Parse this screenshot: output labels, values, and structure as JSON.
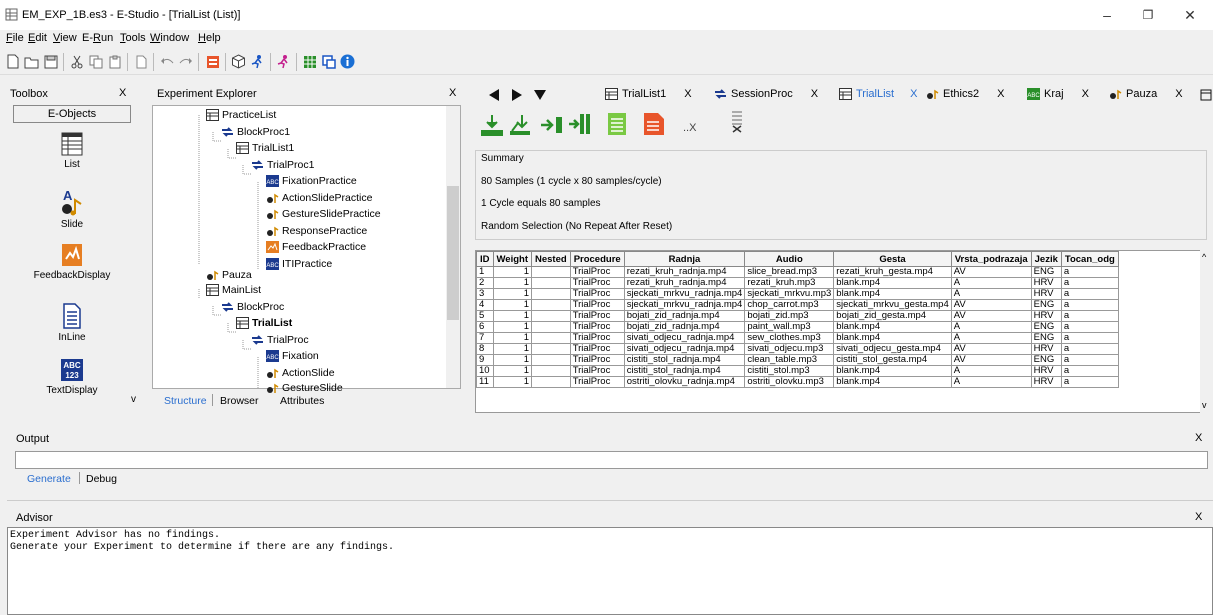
{
  "window": {
    "title": "EM_EXP_1B.es3 - E-Studio - [TrialList (List)]",
    "minimize": "–",
    "restore": "❐",
    "close": "✕"
  },
  "menu": [
    "File",
    "Edit",
    "View",
    "E-Run",
    "Tools",
    "Window",
    "Help"
  ],
  "toolbox": {
    "title": "Toolbox",
    "close": "X",
    "category": "E-Objects",
    "items": [
      "List",
      "Slide",
      "FeedbackDisplay",
      "InLine",
      "TextDisplay"
    ],
    "scroll_indicator": "v"
  },
  "explorer": {
    "title": "Experiment Explorer",
    "close": "X",
    "tree": [
      {
        "label": "PracticeList",
        "type": "list"
      },
      {
        "label": "BlockProc1",
        "type": "proc"
      },
      {
        "label": "TrialList1",
        "type": "list"
      },
      {
        "label": "TrialProc1",
        "type": "proc"
      },
      {
        "label": "FixationPractice",
        "type": "text"
      },
      {
        "label": "ActionSlidePractice",
        "type": "slide"
      },
      {
        "label": "GestureSlidePractice",
        "type": "slide"
      },
      {
        "label": "ResponsePractice",
        "type": "slide"
      },
      {
        "label": "FeedbackPractice",
        "type": "feedback"
      },
      {
        "label": "ITIPractice",
        "type": "text"
      },
      {
        "label": "Pauza",
        "type": "slide"
      },
      {
        "label": "MainList",
        "type": "list"
      },
      {
        "label": "BlockProc",
        "type": "proc"
      },
      {
        "label": "TrialList",
        "type": "list"
      },
      {
        "label": "TrialProc",
        "type": "proc"
      },
      {
        "label": "Fixation",
        "type": "text"
      },
      {
        "label": "ActionSlide",
        "type": "slide"
      },
      {
        "label": "GestureSlide",
        "type": "slide"
      }
    ],
    "tabs": [
      "Structure",
      "Browser",
      "Attributes"
    ]
  },
  "doc_tabs": [
    {
      "label": "TrialList1",
      "close": "X",
      "type": "list"
    },
    {
      "label": "SessionProc",
      "close": "X",
      "type": "proc"
    },
    {
      "label": "TrialList",
      "close": "X",
      "type": "list",
      "active": true
    },
    {
      "label": "Ethics2",
      "close": "X",
      "type": "slide"
    },
    {
      "label": "Kraj",
      "close": "X",
      "type": "text"
    },
    {
      "label": "Pauza",
      "close": "X",
      "type": "slide"
    }
  ],
  "summary": {
    "title": "Summary",
    "lines": [
      "80 Samples (1 cycle x 80 samples/cycle)",
      "1 Cycle equals 80 samples",
      "Random Selection  (No Repeat After Reset)"
    ]
  },
  "list_tool_extra": "..X",
  "grid": {
    "columns": [
      "ID",
      "Weight",
      "Nested",
      "Procedure",
      "Radnja",
      "Audio",
      "Gesta",
      "Vrsta_podrazaja",
      "Jezik",
      "Tocan_odg"
    ],
    "rows": [
      [
        "1",
        "1",
        "",
        "TrialProc",
        "rezati_kruh_radnja.mp4",
        "slice_bread.mp3",
        "rezati_kruh_gesta.mp4",
        "AV",
        "ENG",
        "a"
      ],
      [
        "2",
        "1",
        "",
        "TrialProc",
        "rezati_kruh_radnja.mp4",
        "rezati_kruh.mp3",
        "blank.mp4",
        "A",
        "HRV",
        "a"
      ],
      [
        "3",
        "1",
        "",
        "TrialProc",
        "sjeckati_mrkvu_radnja.mp4",
        "sjeckati_mrkvu.mp3",
        "blank.mp4",
        "A",
        "HRV",
        "a"
      ],
      [
        "4",
        "1",
        "",
        "TrialProc",
        "sjeckati_mrkvu_radnja.mp4",
        "chop_carrot.mp3",
        "sjeckati_mrkvu_gesta.mp4",
        "AV",
        "ENG",
        "a"
      ],
      [
        "5",
        "1",
        "",
        "TrialProc",
        "bojati_zid_radnja.mp4",
        "bojati_zid.mp3",
        "bojati_zid_gesta.mp4",
        "AV",
        "HRV",
        "a"
      ],
      [
        "6",
        "1",
        "",
        "TrialProc",
        "bojati_zid_radnja.mp4",
        "paint_wall.mp3",
        "blank.mp4",
        "A",
        "ENG",
        "a"
      ],
      [
        "7",
        "1",
        "",
        "TrialProc",
        "sivati_odjecu_radnja.mp4",
        "sew_clothes.mp3",
        "blank.mp4",
        "A",
        "ENG",
        "a"
      ],
      [
        "8",
        "1",
        "",
        "TrialProc",
        "sivati_odjecu_radnja.mp4",
        "sivati_odjecu.mp3",
        "sivati_odjecu_gesta.mp4",
        "AV",
        "HRV",
        "a"
      ],
      [
        "9",
        "1",
        "",
        "TrialProc",
        "cistiti_stol_radnja.mp4",
        "clean_table.mp3",
        "cistiti_stol_gesta.mp4",
        "AV",
        "ENG",
        "a"
      ],
      [
        "10",
        "1",
        "",
        "TrialProc",
        "cistiti_stol_radnja.mp4",
        "cistiti_stol.mp3",
        "blank.mp4",
        "A",
        "HRV",
        "a"
      ],
      [
        "11",
        "1",
        "",
        "TrialProc",
        "ostriti_olovku_radnja.mp4",
        "ostriti_olovku.mp3",
        "blank.mp4",
        "A",
        "HRV",
        "a"
      ]
    ]
  },
  "output": {
    "title": "Output",
    "close": "X",
    "tabs": [
      "Generate",
      "Debug"
    ]
  },
  "advisor": {
    "title": "Advisor",
    "close": "X",
    "lines": [
      "Experiment Advisor has no findings.",
      "Generate your Experiment to determine if there are any findings."
    ]
  }
}
